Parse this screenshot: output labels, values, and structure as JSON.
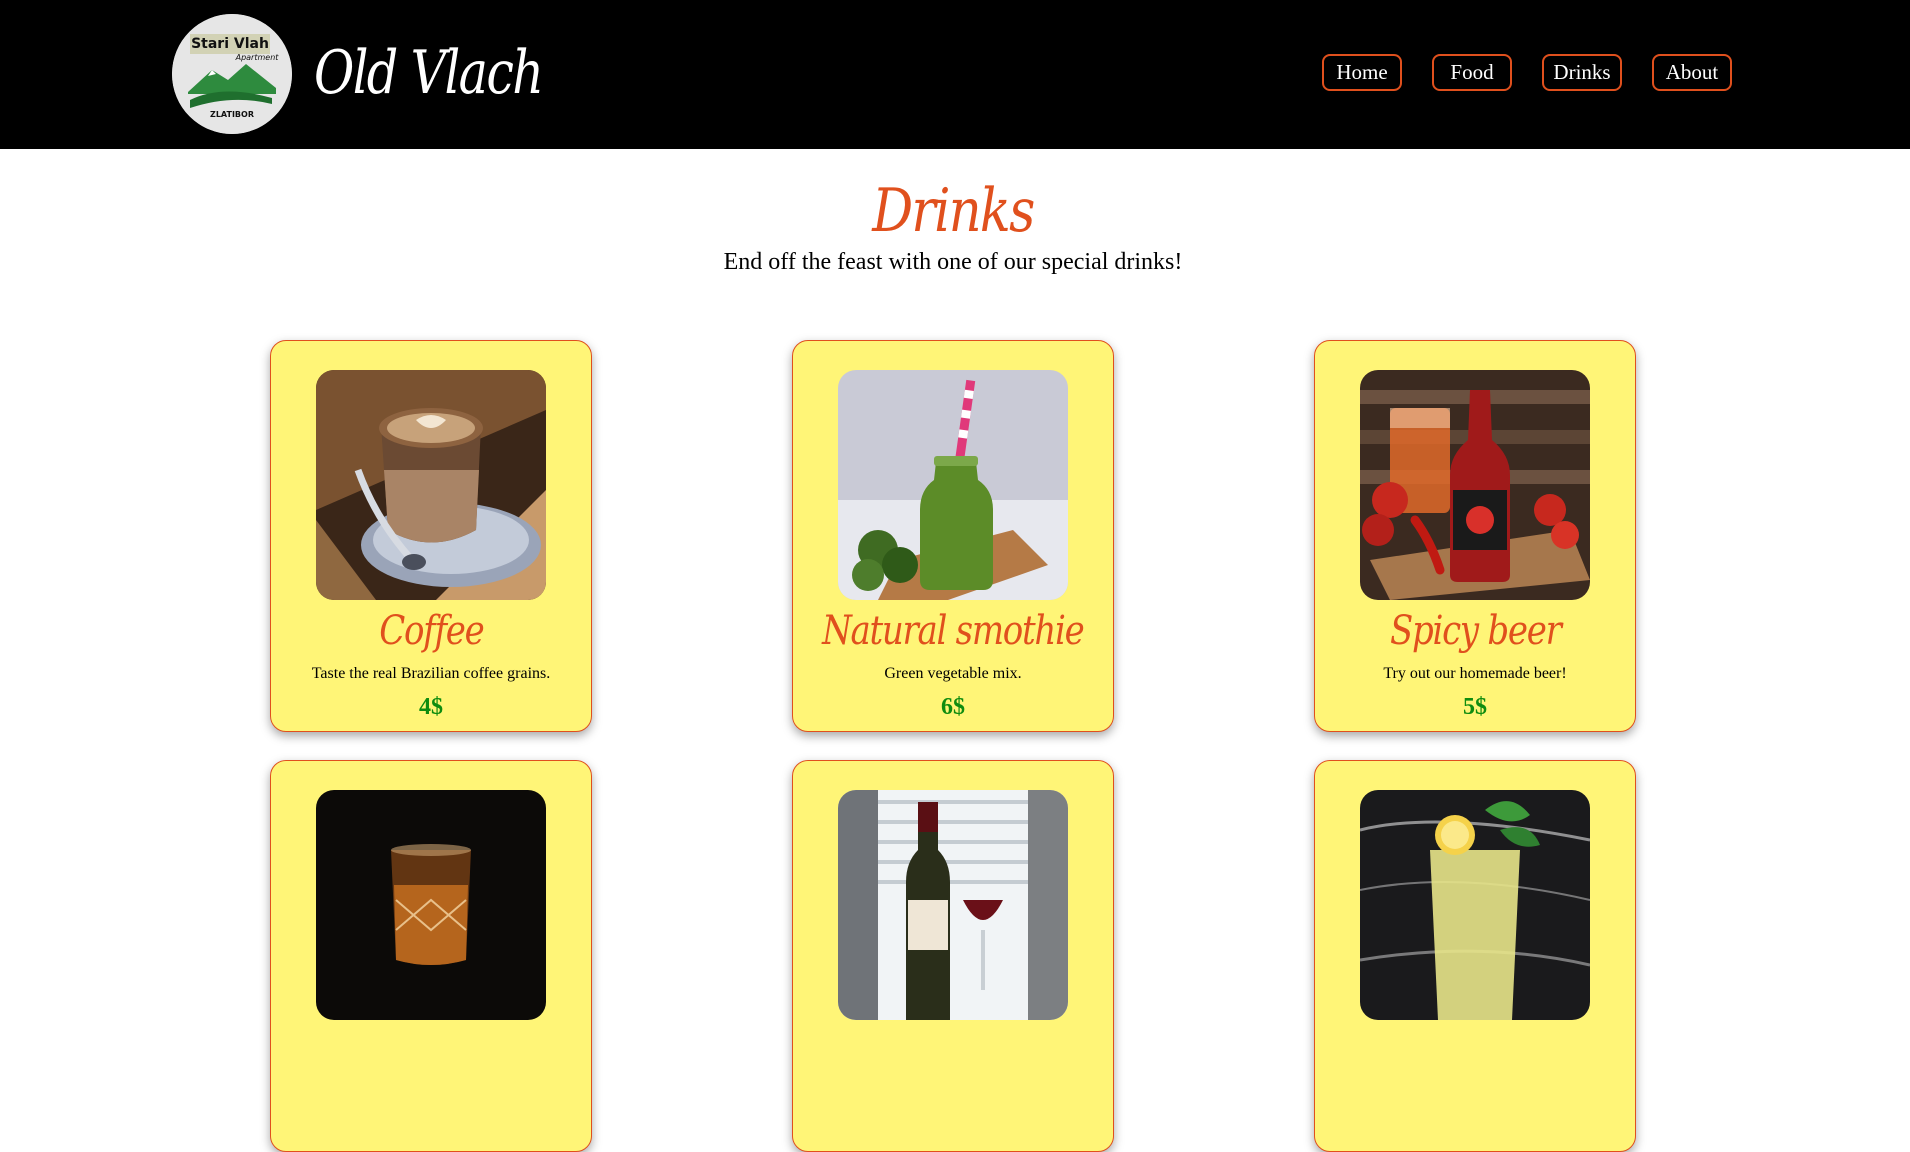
{
  "header": {
    "logo": {
      "line1": "Stari Vlah",
      "line2": "Apartment",
      "line3": "ZLATIBOR"
    },
    "site_name": "Old Vlach",
    "nav": [
      {
        "label": "Home"
      },
      {
        "label": "Food"
      },
      {
        "label": "Drinks"
      },
      {
        "label": "About"
      }
    ]
  },
  "main": {
    "title": "Drinks",
    "subtitle": "End off the feast with one of our special drinks!",
    "cards": [
      {
        "name": "Coffee",
        "description": "Taste the real Brazilian coffee grains.",
        "price": "4$",
        "image": "coffee-photo"
      },
      {
        "name": "Natural smothie",
        "description": "Green vegetable mix.",
        "price": "6$",
        "image": "green-smoothie-photo"
      },
      {
        "name": "Spicy beer",
        "description": "Try out our homemade beer!",
        "price": "5$",
        "image": "spicy-beer-photo"
      },
      {
        "name": "",
        "description": "",
        "price": "",
        "image": "whiskey-glass-photo"
      },
      {
        "name": "",
        "description": "",
        "price": "",
        "image": "wine-bottle-photo"
      },
      {
        "name": "",
        "description": "",
        "price": "",
        "image": "lemonade-photo"
      }
    ]
  },
  "colors": {
    "header_bg": "#000000",
    "accent": "#e0501d",
    "card_bg": "#fff577",
    "price": "#0f8c0f"
  }
}
